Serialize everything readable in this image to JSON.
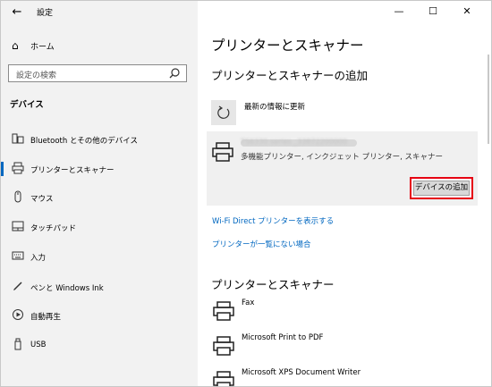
{
  "app": {
    "title": "設定"
  },
  "window_controls": {
    "minimize": "—",
    "maximize": "☐",
    "close": "✕"
  },
  "sidebar": {
    "home_label": "ホーム",
    "search_placeholder": "設定の検索",
    "section_title": "デバイス",
    "items": [
      {
        "label": "Bluetooth とその他のデバイス",
        "icon": "bluetooth-devices-icon",
        "active": false
      },
      {
        "label": "プリンターとスキャナー",
        "icon": "printer-icon",
        "active": true
      },
      {
        "label": "マウス",
        "icon": "mouse-icon",
        "active": false
      },
      {
        "label": "タッチパッド",
        "icon": "touchpad-icon",
        "active": false
      },
      {
        "label": "入力",
        "icon": "keyboard-icon",
        "active": false
      },
      {
        "label": "ペンと Windows Ink",
        "icon": "pen-icon",
        "active": false
      },
      {
        "label": "自動再生",
        "icon": "autoplay-icon",
        "active": false
      },
      {
        "label": "USB",
        "icon": "usb-icon",
        "active": false
      }
    ]
  },
  "main": {
    "title": "プリンターとスキャナー",
    "add_section_title": "プリンターとスキャナーの追加",
    "refresh_label": "最新の情報に更新",
    "found_device": {
      "name_blurred": "TS6330 series _33872200000",
      "type": "多機能プリンター, インクジェット プリンター, スキャナー",
      "add_button": "デバイスの追加"
    },
    "links": {
      "wifi_direct": "Wi-Fi Direct プリンターを表示する",
      "not_listed": "プリンターが一覧にない場合"
    },
    "list_section_title": "プリンターとスキャナー",
    "printers": [
      {
        "name": "Fax"
      },
      {
        "name": "Microsoft Print to PDF"
      },
      {
        "name": "Microsoft XPS Document Writer"
      }
    ]
  },
  "colors": {
    "accent": "#0067c0",
    "highlight": "#e60012",
    "sidebar_bg": "#f2f2f2"
  }
}
